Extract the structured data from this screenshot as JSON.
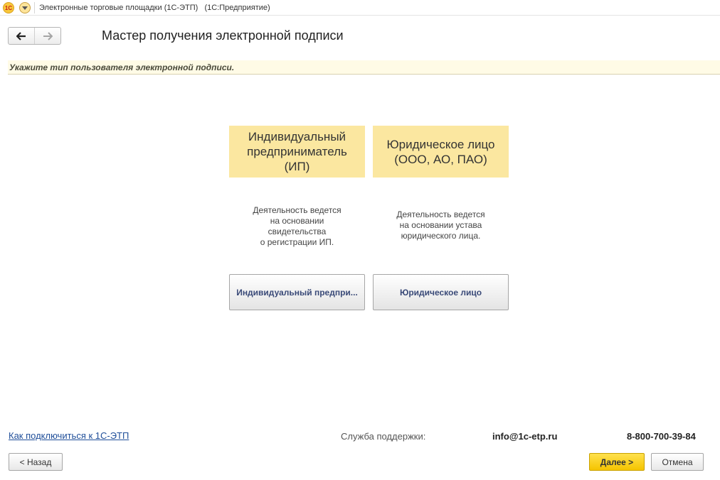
{
  "window": {
    "title": "Электронные торговые площадки (1С-ЭТП)   (1С:Предприятие)",
    "logo_text": "1С"
  },
  "nav": {
    "back_symbol": "🡐",
    "forward_symbol": "🡒"
  },
  "page": {
    "title": "Мастер получения электронной подписи",
    "hint": "Укажите тип пользователя электронной подписи."
  },
  "options": {
    "ip": {
      "title_line1": "Индивидуальный",
      "title_line2": "предприниматель",
      "title_line3": "(ИП)",
      "desc_line1": "Деятельность ведется",
      "desc_line2": "на основании",
      "desc_line3": "свидетельства",
      "desc_line4": "о регистрации ИП.",
      "button_label": "Индивидуальный предпри..."
    },
    "ul": {
      "title_line1": "Юридическое лицо",
      "title_line2": "(ООО, АО, ПАО)",
      "desc_line1": "Деятельность ведется",
      "desc_line2": "на основании устава",
      "desc_line3": "юридического лица.",
      "button_label": "Юридическое лицо"
    }
  },
  "footer": {
    "help_link": "Как подключиться к 1С-ЭТП",
    "support_label": "Служба поддержки:",
    "support_email": "info@1c-etp.ru",
    "support_phone": "8-800-700-39-84",
    "back_button": "< Назад",
    "next_button": "Далее >",
    "cancel_button": "Отмена"
  },
  "colors": {
    "accent_yellow": "#fbe7a0",
    "next_button": "#f5c400",
    "link": "#1f4e99"
  }
}
